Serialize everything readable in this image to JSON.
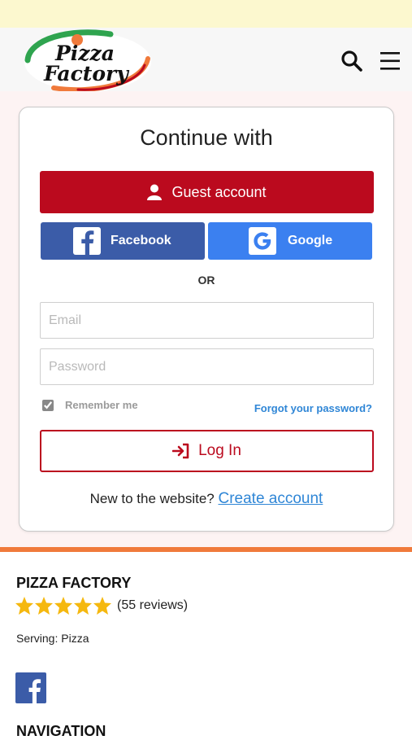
{
  "brand": {
    "logo_line1": "Pizza",
    "logo_line2": "Factory",
    "colors": {
      "red": "#bb0a1e",
      "orange": "#f07a3b",
      "green": "#2fa44f",
      "facebook": "#3b5ca8",
      "google": "#3b80f0",
      "link": "#2f86d6"
    }
  },
  "header": {
    "search_icon": "search-icon",
    "menu_icon": "hamburger-menu-icon"
  },
  "login": {
    "title": "Continue with",
    "guest_label": "Guest account",
    "facebook_label": "Facebook",
    "google_label": "Google",
    "or_text": "OR",
    "email_placeholder": "Email",
    "email_value": "",
    "password_placeholder": "Password",
    "password_value": "",
    "remember_label": "Remember me",
    "remember_checked": true,
    "forgot_label": "Forgot your password?",
    "login_label": "Log In",
    "signup_prompt": "New to the website?",
    "create_account_label": "Create account"
  },
  "business": {
    "name": "PIZZA FACTORY",
    "rating": 5,
    "rating_max": 5,
    "reviews_text": "(55 reviews)",
    "serving_text": "Serving: Pizza",
    "social_icon": "facebook-icon",
    "nav_heading": "NAVIGATION"
  }
}
